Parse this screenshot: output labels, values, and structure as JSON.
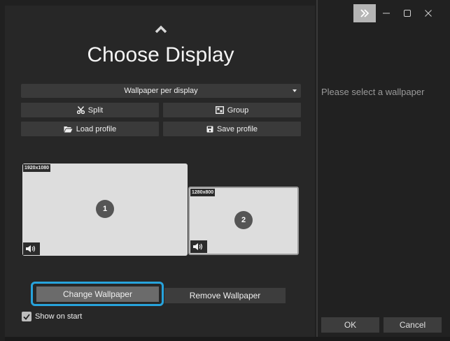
{
  "left": {
    "title": "Choose Display",
    "mode_dropdown": {
      "selected": "Wallpaper per display"
    },
    "buttons": {
      "split": "Split",
      "group": "Group",
      "load_profile": "Load profile",
      "save_profile": "Save profile"
    },
    "displays": [
      {
        "resolution": "1920x1080",
        "number": "1"
      },
      {
        "resolution": "1280x800",
        "number": "2"
      }
    ],
    "change_wallpaper": "Change Wallpaper",
    "remove_wallpaper": "Remove Wallpaper",
    "show_on_start": {
      "label": "Show on start",
      "checked": true
    }
  },
  "right": {
    "placeholder": "Please select a wallpaper",
    "ok": "OK",
    "cancel": "Cancel"
  },
  "colors": {
    "focus_ring": "#27a3dc",
    "background": "#272727",
    "button": "#3a3a3a"
  }
}
